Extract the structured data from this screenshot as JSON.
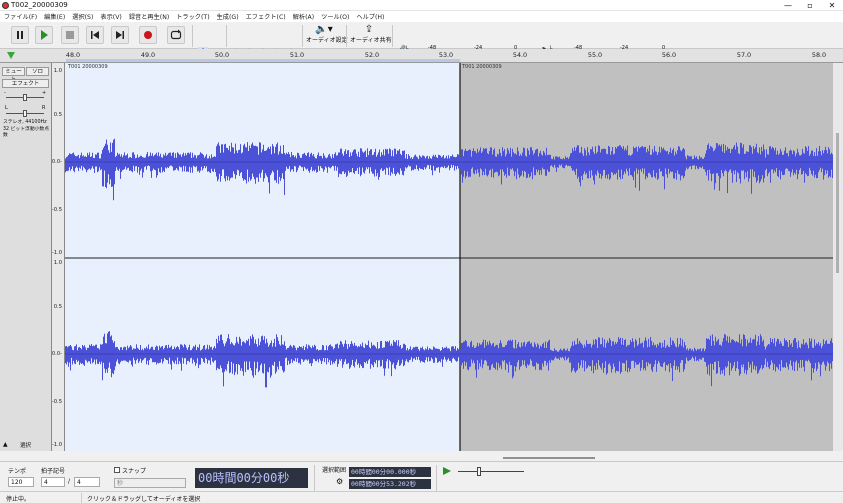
{
  "window": {
    "title": "T002_20000309"
  },
  "menu": [
    "ファイル(F)",
    "編集(E)",
    "選択(S)",
    "表示(V)",
    "録音と再生(N)",
    "トラック(T)",
    "生成(G)",
    "エフェクト(C)",
    "解析(A)",
    "ツール(O)",
    "ヘルプ(H)"
  ],
  "toolbar": {
    "audio_setup": "オーディオ設定",
    "share_audio": "オーディオ共有"
  },
  "meters": {
    "record_ticks": [
      "-48",
      "-24",
      "0"
    ],
    "play_ticks": [
      "-48",
      "-24",
      "0"
    ],
    "rec_lr": [
      "L",
      "R"
    ],
    "play_lr": [
      "L",
      "R"
    ]
  },
  "timeline": {
    "ticks": [
      "48.0",
      "49.0",
      "50.0",
      "51.0",
      "52.0",
      "53.0",
      "54.0",
      "55.0",
      "56.0",
      "57.0",
      "58.0"
    ]
  },
  "track": {
    "mute": "ミュート",
    "solo": "ソロ",
    "effects": "エフェクト",
    "gain_minus": "-",
    "gain_plus": "+",
    "pan_l": "L",
    "pan_r": "R",
    "info": "ステレオ, 44100Hz\n32 ビット浮動小数点数",
    "select": "選択",
    "clip_name_left": "T001 20000309",
    "clip_name_right": "T001 20000309",
    "scale_labels": [
      "1.0",
      "0.5",
      "0.0-",
      "-0.5",
      "-1.0"
    ]
  },
  "bottom": {
    "tempo_label": "テンポ",
    "tempo_value": "120",
    "timesig_label": "拍子記号",
    "timesig_num": "4",
    "timesig_sep": "/",
    "timesig_den": "4",
    "snap_label": "スナップ",
    "snap_value": "秒",
    "time_display": "00時間00分00秒",
    "selection_label": "選択範囲",
    "sel_start": "00時間00分00.000秒",
    "sel_end": "00時間00分53.202秒"
  },
  "status": {
    "left": "停止中。",
    "hint": "クリック＆ドラッグしてオーディオを選択"
  },
  "colors": {
    "waveform": "#4c52d8",
    "selected_bg": "#e7f0fc",
    "unselected_bg": "#c0c0c0"
  }
}
